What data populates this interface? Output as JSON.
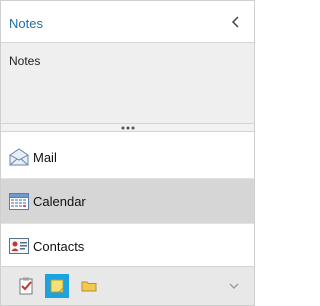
{
  "header": {
    "title": "Notes"
  },
  "content": {
    "text": "Notes"
  },
  "nav": {
    "items": [
      {
        "label": "Mail",
        "icon": "mail-icon"
      },
      {
        "label": "Calendar",
        "icon": "calendar-icon",
        "selected": true
      },
      {
        "label": "Contacts",
        "icon": "contacts-icon"
      }
    ]
  },
  "bottom_bar": {
    "buttons": [
      {
        "icon": "tasks-icon"
      },
      {
        "icon": "notes-icon",
        "selected": true
      },
      {
        "icon": "folder-icon"
      }
    ],
    "more_icon": "chevron-down-icon"
  },
  "colors": {
    "title": "#1f6fa8",
    "selection": "#d6d6d6",
    "active_button": "#19a3e0"
  }
}
